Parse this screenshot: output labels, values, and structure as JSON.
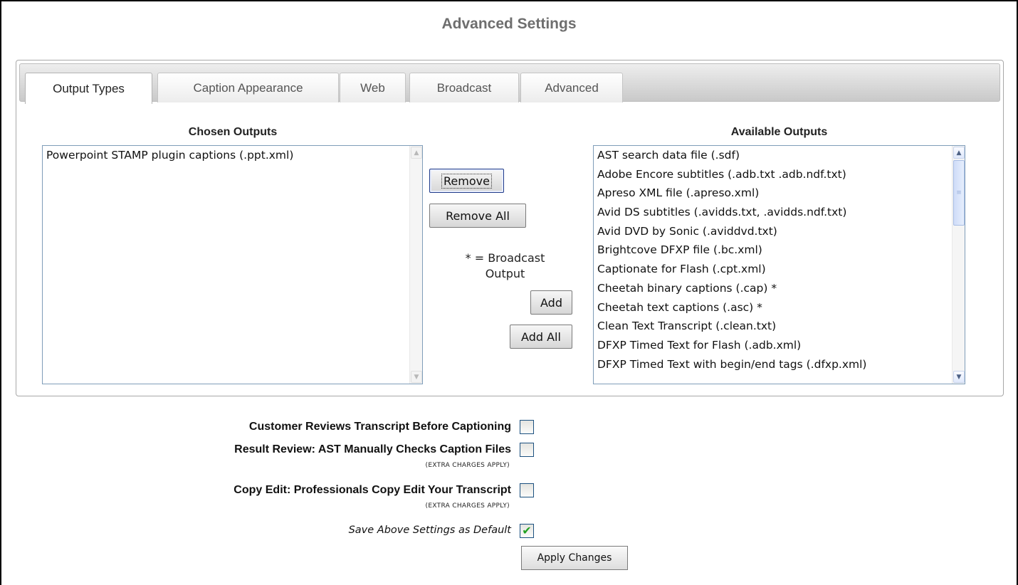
{
  "page": {
    "title": "Advanced Settings"
  },
  "tabs": [
    {
      "label": "Output Types",
      "active": true
    },
    {
      "label": "Caption Appearance",
      "active": false
    },
    {
      "label": "Web",
      "active": false
    },
    {
      "label": "Broadcast",
      "active": false
    },
    {
      "label": "Advanced",
      "active": false
    }
  ],
  "chosen": {
    "heading": "Chosen Outputs",
    "items": [
      "Powerpoint STAMP plugin captions (.ppt.xml)"
    ]
  },
  "available": {
    "heading": "Available Outputs",
    "items": [
      "AST search data file (.sdf)",
      "Adobe Encore subtitles (.adb.txt .adb.ndf.txt)",
      "Apreso XML file (.apreso.xml)",
      "Avid DS subtitles (.avidds.txt, .avidds.ndf.txt)",
      "Avid DVD by Sonic (.aviddvd.txt)",
      "Brightcove DFXP file (.bc.xml)",
      "Captionate for Flash (.cpt.xml)",
      "Cheetah binary captions (.cap) *",
      "Cheetah text captions (.asc) *",
      "Clean Text Transcript (.clean.txt)",
      "DFXP Timed Text for Flash (.adb.xml)",
      "DFXP Timed Text with begin/end tags (.dfxp.xml)"
    ]
  },
  "buttons": {
    "remove": "Remove",
    "remove_all": "Remove All",
    "add": "Add",
    "add_all": "Add All",
    "apply": "Apply Changes"
  },
  "broadcast_note": {
    "line1": "* = Broadcast",
    "line2": "Output"
  },
  "options": {
    "customer_review": {
      "label": "Customer Reviews Transcript Before Captioning",
      "checked": false
    },
    "result_review": {
      "label": "Result Review: AST Manually Checks Caption Files",
      "note": "(EXTRA CHARGES APPLY)",
      "checked": false
    },
    "copy_edit": {
      "label": "Copy Edit: Professionals Copy Edit Your Transcript",
      "note": "(EXTRA CHARGES APPLY)",
      "checked": false
    },
    "save_default": {
      "label": "Save Above Settings as Default",
      "checked": true,
      "check_glyph": "✔"
    }
  },
  "icons": {
    "scroll_up": "▲",
    "scroll_down": "▼",
    "grip": "≡"
  },
  "colors": {
    "title": "#6e6e6e",
    "check": "#21a121",
    "listbox_border": "#7f9db9"
  }
}
